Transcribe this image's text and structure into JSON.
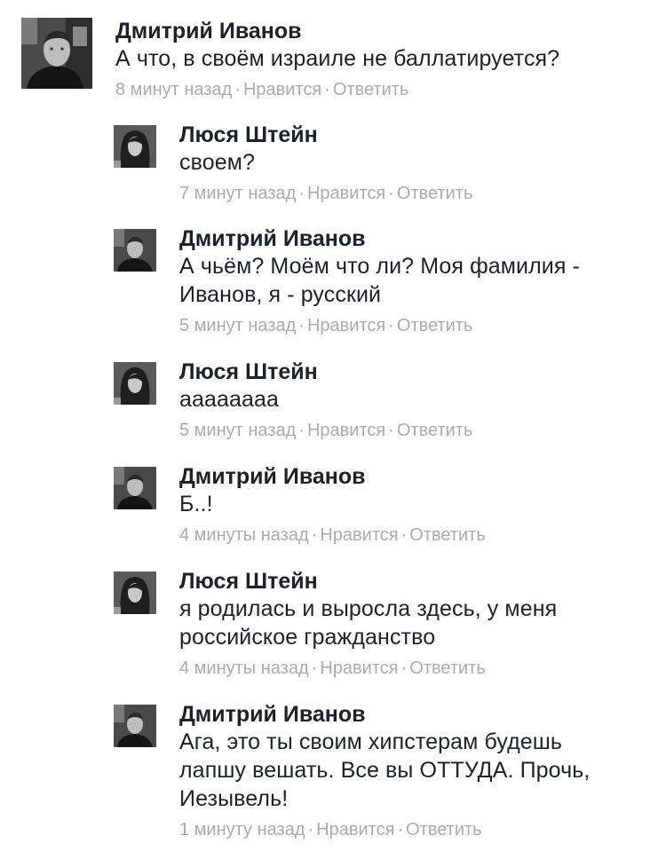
{
  "comments": [
    {
      "author": "Дмитрий Иванов",
      "avatar_icon": "male-profile-photo-icon",
      "lines": [
        "А что, в своём израиле не баллатируется?"
      ],
      "time": "8 минут назад",
      "like": "Нравится",
      "reply": "Ответить"
    }
  ],
  "replies": [
    {
      "author": "Люся Штейн",
      "avatar_icon": "female-profile-photo-icon",
      "lines": [
        "своем?"
      ],
      "time": "7 минут назад",
      "like": "Нравится",
      "reply": "Ответить"
    },
    {
      "author": "Дмитрий Иванов",
      "avatar_icon": "male-profile-photo-icon",
      "lines": [
        "А чьём? Моём что ли? Моя фамилия -",
        "Иванов, я - русский"
      ],
      "time": "5 минут назад",
      "like": "Нравится",
      "reply": "Ответить"
    },
    {
      "author": "Люся Штейн",
      "avatar_icon": "female-profile-photo-icon",
      "lines": [
        "ааааааaа"
      ],
      "time": "5 минут назад",
      "like": "Нравится",
      "reply": "Ответить"
    },
    {
      "author": "Дмитрий Иванов",
      "avatar_icon": "male-profile-photo-icon",
      "lines": [
        "Б..!"
      ],
      "time": "4 минуты назад",
      "like": "Нравится",
      "reply": "Ответить"
    },
    {
      "author": "Люся Штейн",
      "avatar_icon": "female-profile-photo-icon",
      "lines": [
        "я родилась и выросла здесь, у меня",
        "российское гражданство"
      ],
      "time": "4 минуты назад",
      "like": "Нравится",
      "reply": "Ответить"
    },
    {
      "author": "Дмитрий Иванов",
      "avatar_icon": "male-profile-photo-icon",
      "lines": [
        "Ага, это ты своим хипстерам будешь",
        "лапшу вешать. Все вы ОТТУДА. Прочь,",
        "Иезывель!"
      ],
      "time": "1 минуту назад",
      "like": "Нравится",
      "reply": "Ответить"
    }
  ],
  "separator": "·"
}
